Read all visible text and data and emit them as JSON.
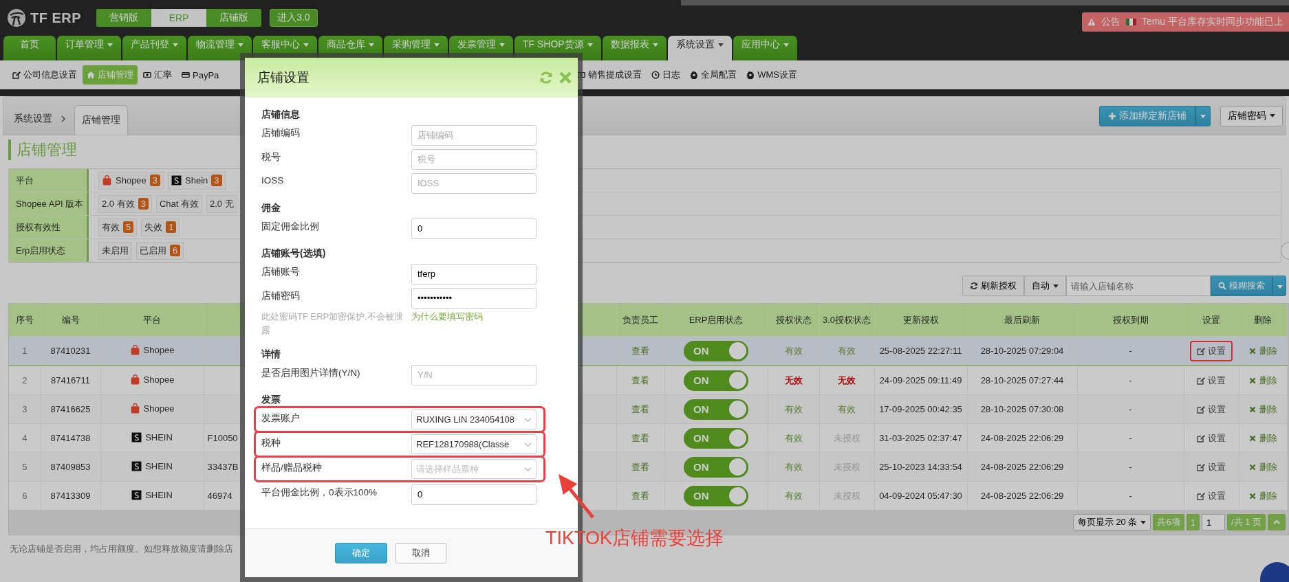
{
  "top_bar": {
    "logo": "TF ERP",
    "editions": [
      {
        "label": "营销版",
        "selected": false
      },
      {
        "label": "ERP",
        "selected": true
      },
      {
        "label": "店铺版",
        "selected": false
      }
    ],
    "enter_button": "进入3.0",
    "announcement": {
      "label": "公告",
      "text": "Temu 平台库存实时同步功能已上"
    }
  },
  "main_nav": [
    {
      "label": "首页",
      "dropdown": false,
      "selected": false
    },
    {
      "label": "订单管理",
      "dropdown": true,
      "selected": false
    },
    {
      "label": "产品刊登",
      "dropdown": true,
      "selected": false
    },
    {
      "label": "物流管理",
      "dropdown": true,
      "selected": false
    },
    {
      "label": "客服中心",
      "dropdown": true,
      "selected": false
    },
    {
      "label": "商品仓库",
      "dropdown": true,
      "selected": false
    },
    {
      "label": "采购管理",
      "dropdown": true,
      "selected": false
    },
    {
      "label": "发票管理",
      "dropdown": true,
      "selected": false
    },
    {
      "label": "TF SHOP货源",
      "dropdown": true,
      "selected": false
    },
    {
      "label": "数据报表",
      "dropdown": true,
      "selected": false
    },
    {
      "label": "系统设置",
      "dropdown": true,
      "selected": true
    },
    {
      "label": "应用中心",
      "dropdown": true,
      "selected": false
    }
  ],
  "sub_nav": {
    "left": [
      {
        "label": "公司信息设置",
        "selected": false
      },
      {
        "label": "店铺管理",
        "selected": true
      },
      {
        "label": "汇率",
        "selected": false
      },
      {
        "label": "PayPa",
        "selected": false
      }
    ],
    "right": [
      {
        "label": "销售提成设置",
        "selected": false
      },
      {
        "label": "日志",
        "selected": false
      },
      {
        "label": "全局配置",
        "selected": false
      },
      {
        "label": "WMS设置",
        "selected": false
      }
    ]
  },
  "breadcrumb": {
    "parent": "系统设置",
    "current": "店铺管理"
  },
  "header_buttons": {
    "add": "添加绑定新店铺",
    "password": "店铺密码"
  },
  "page_title": "店铺管理",
  "filters": [
    {
      "label": "平台",
      "options": [
        {
          "label": "Shopee",
          "kind": "shopee",
          "count": "3"
        },
        {
          "label": "Shein",
          "kind": "shein",
          "count": "3"
        }
      ]
    },
    {
      "label": "Shopee API 版本",
      "options": [
        {
          "label": "2.0 有效",
          "count": "3"
        },
        {
          "label": "Chat 有效"
        },
        {
          "label": "2.0 无"
        }
      ]
    },
    {
      "label": "授权有效性",
      "options": [
        {
          "label": "有效",
          "count": "5"
        },
        {
          "label": "失效",
          "count": "1"
        }
      ]
    },
    {
      "label": "Erp启用状态",
      "options": [
        {
          "label": "未启用"
        },
        {
          "label": "已启用",
          "count": "6"
        }
      ]
    }
  ],
  "toolbar": {
    "refresh": "刷新授权",
    "auto": "自动",
    "search_placeholder": "请输入店铺名称",
    "search_button": "模糊搜索"
  },
  "table": {
    "columns": [
      "序号",
      "编号",
      "平台",
      "负责员工",
      "ERP启用状态",
      "授权状态",
      "3.0授权状态",
      "更新授权",
      "最后刷新",
      "授权到期",
      "设置",
      "删除"
    ],
    "rows": [
      {
        "no": "1",
        "id": "87410231",
        "platform": "Shopee",
        "kind": "shopee",
        "staff": "查看",
        "erp_on": true,
        "erp_label": "ON",
        "auth": "有效",
        "auth_invalid": false,
        "auth3": "有效",
        "auth3_invalid": false,
        "auth3_authorized": true,
        "updated": "25-08-2025 22:27:11",
        "refreshed": "28-10-2025 07:29:04",
        "expires": "-",
        "settings": "设置",
        "settings_highlighted": true,
        "delete": "删除",
        "selected": true
      },
      {
        "no": "2",
        "id": "87416711",
        "platform": "Shopee",
        "kind": "shopee",
        "staff": "查看",
        "erp_on": true,
        "erp_label": "ON",
        "auth": "无效",
        "auth_invalid": true,
        "auth3": "无效",
        "auth3_invalid": true,
        "auth3_authorized": true,
        "updated": "24-09-2025 09:11:49",
        "refreshed": "28-10-2025 07:27:44",
        "expires": "-",
        "settings": "设置",
        "settings_highlighted": false,
        "delete": "删除",
        "selected": false
      },
      {
        "no": "3",
        "id": "87416625",
        "platform": "Shopee",
        "kind": "shopee",
        "staff": "查看",
        "erp_on": true,
        "erp_label": "ON",
        "auth": "有效",
        "auth_invalid": false,
        "auth3": "有效",
        "auth3_invalid": false,
        "auth3_authorized": true,
        "updated": "17-09-2025 00:42:35",
        "refreshed": "28-10-2025 07:30:08",
        "expires": "-",
        "settings": "设置",
        "settings_highlighted": false,
        "delete": "删除",
        "selected": false
      },
      {
        "no": "4",
        "id": "87414738",
        "platform": "SHEIN",
        "kind": "shein",
        "column_4": "F10050",
        "staff": "查看",
        "erp_on": true,
        "erp_label": "ON",
        "auth": "有效",
        "auth_invalid": false,
        "auth3": "未授权",
        "auth3_invalid": false,
        "auth3_authorized": false,
        "updated": "31-03-2025 02:37:47",
        "refreshed": "24-08-2025 22:06:29",
        "expires": "-",
        "settings": "设置",
        "settings_highlighted": false,
        "delete": "删除",
        "selected": false
      },
      {
        "no": "5",
        "id": "87409853",
        "platform": "SHEIN",
        "kind": "shein",
        "column_4": "33437B",
        "staff": "查看",
        "erp_on": true,
        "erp_label": "ON",
        "auth": "有效",
        "auth_invalid": false,
        "auth3": "未授权",
        "auth3_invalid": false,
        "auth3_authorized": false,
        "updated": "25-10-2023 14:33:54",
        "refreshed": "24-08-2025 22:06:29",
        "expires": "-",
        "settings": "设置",
        "settings_highlighted": false,
        "delete": "删除",
        "selected": false
      },
      {
        "no": "6",
        "id": "87413309",
        "platform": "SHEIN",
        "kind": "shein",
        "column_4": "46974",
        "staff": "查看",
        "erp_on": true,
        "erp_label": "ON",
        "auth": "有效",
        "auth_invalid": false,
        "auth3": "未授权",
        "auth3_invalid": false,
        "auth3_authorized": false,
        "updated": "04-09-2024 05:47:30",
        "refreshed": "24-08-2025 22:06:29",
        "expires": "-",
        "settings": "设置",
        "settings_highlighted": false,
        "delete": "删除",
        "selected": false
      }
    ]
  },
  "pager": {
    "per_page": "每页显示 20 条",
    "total": "共6项",
    "page_button": "1",
    "page_input": "1",
    "pages": "/共 1 页"
  },
  "note": "无论店铺是否启用，均占用额度。如想释放额度请删除店",
  "modal": {
    "title": "店铺设置",
    "sections": [
      {
        "heading": "店铺信息",
        "fields": [
          {
            "kind": "input",
            "label": "店铺编码",
            "placeholder": "店铺编码",
            "highlighted": false
          },
          {
            "kind": "input",
            "label": "税号",
            "placeholder": "税号",
            "highlighted": false
          },
          {
            "kind": "input",
            "label": "IOSS",
            "placeholder": "IOSS",
            "highlighted": false
          }
        ]
      },
      {
        "heading": "佣金",
        "fields": [
          {
            "kind": "input",
            "label": "固定佣金比例",
            "value": "0",
            "highlighted": false
          }
        ]
      },
      {
        "heading": "店铺账号(选填)",
        "fields": [
          {
            "kind": "input",
            "label": "店铺账号",
            "value": "tferp",
            "highlighted": false
          },
          {
            "kind": "input",
            "label": "店铺密码",
            "value": "•••••••••••",
            "highlighted": false
          },
          {
            "kind": "note",
            "label": "此处密码TF ERP加密保护,不会被泄露",
            "link": "为什么要填写密码"
          }
        ]
      },
      {
        "heading": "详情",
        "fields": [
          {
            "kind": "input",
            "label": "是否启用图片详情(Y/N)",
            "placeholder": "Y/N",
            "highlighted": false
          }
        ]
      },
      {
        "heading": "发票",
        "fields": [
          {
            "kind": "select",
            "label": "发票账户",
            "value": "RUXING LIN 234054108",
            "highlighted": true
          },
          {
            "kind": "select",
            "label": "税种",
            "value": "REF128170988(Classe",
            "highlighted": true
          },
          {
            "kind": "select",
            "label": "样品/赠品税种",
            "placeholder": "请选择样品票种",
            "highlighted": true
          },
          {
            "kind": "input",
            "label": "平台佣金比例，0表示100%",
            "value": "0",
            "highlighted": false
          }
        ]
      }
    ],
    "ok": "确定",
    "cancel": "取消"
  },
  "annotation": {
    "text": "TIKTOK店铺需要选择"
  }
}
